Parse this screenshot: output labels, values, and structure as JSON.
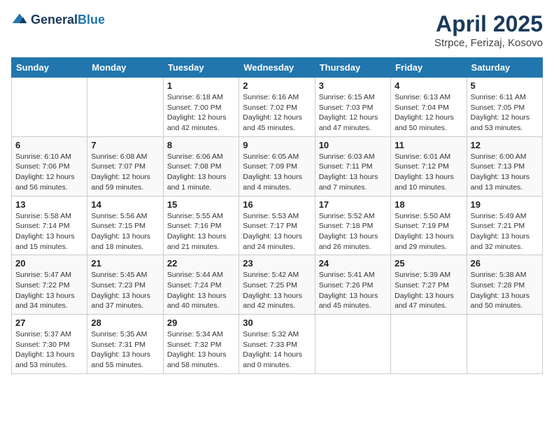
{
  "header": {
    "logo_general": "General",
    "logo_blue": "Blue",
    "month_title": "April 2025",
    "location": "Strpce, Ferizaj, Kosovo"
  },
  "weekdays": [
    "Sunday",
    "Monday",
    "Tuesday",
    "Wednesday",
    "Thursday",
    "Friday",
    "Saturday"
  ],
  "weeks": [
    [
      {
        "day": "",
        "content": ""
      },
      {
        "day": "",
        "content": ""
      },
      {
        "day": "1",
        "content": "Sunrise: 6:18 AM\nSunset: 7:00 PM\nDaylight: 12 hours and 42 minutes."
      },
      {
        "day": "2",
        "content": "Sunrise: 6:16 AM\nSunset: 7:02 PM\nDaylight: 12 hours and 45 minutes."
      },
      {
        "day": "3",
        "content": "Sunrise: 6:15 AM\nSunset: 7:03 PM\nDaylight: 12 hours and 47 minutes."
      },
      {
        "day": "4",
        "content": "Sunrise: 6:13 AM\nSunset: 7:04 PM\nDaylight: 12 hours and 50 minutes."
      },
      {
        "day": "5",
        "content": "Sunrise: 6:11 AM\nSunset: 7:05 PM\nDaylight: 12 hours and 53 minutes."
      }
    ],
    [
      {
        "day": "6",
        "content": "Sunrise: 6:10 AM\nSunset: 7:06 PM\nDaylight: 12 hours and 56 minutes."
      },
      {
        "day": "7",
        "content": "Sunrise: 6:08 AM\nSunset: 7:07 PM\nDaylight: 12 hours and 59 minutes."
      },
      {
        "day": "8",
        "content": "Sunrise: 6:06 AM\nSunset: 7:08 PM\nDaylight: 13 hours and 1 minute."
      },
      {
        "day": "9",
        "content": "Sunrise: 6:05 AM\nSunset: 7:09 PM\nDaylight: 13 hours and 4 minutes."
      },
      {
        "day": "10",
        "content": "Sunrise: 6:03 AM\nSunset: 7:11 PM\nDaylight: 13 hours and 7 minutes."
      },
      {
        "day": "11",
        "content": "Sunrise: 6:01 AM\nSunset: 7:12 PM\nDaylight: 13 hours and 10 minutes."
      },
      {
        "day": "12",
        "content": "Sunrise: 6:00 AM\nSunset: 7:13 PM\nDaylight: 13 hours and 13 minutes."
      }
    ],
    [
      {
        "day": "13",
        "content": "Sunrise: 5:58 AM\nSunset: 7:14 PM\nDaylight: 13 hours and 15 minutes."
      },
      {
        "day": "14",
        "content": "Sunrise: 5:56 AM\nSunset: 7:15 PM\nDaylight: 13 hours and 18 minutes."
      },
      {
        "day": "15",
        "content": "Sunrise: 5:55 AM\nSunset: 7:16 PM\nDaylight: 13 hours and 21 minutes."
      },
      {
        "day": "16",
        "content": "Sunrise: 5:53 AM\nSunset: 7:17 PM\nDaylight: 13 hours and 24 minutes."
      },
      {
        "day": "17",
        "content": "Sunrise: 5:52 AM\nSunset: 7:18 PM\nDaylight: 13 hours and 26 minutes."
      },
      {
        "day": "18",
        "content": "Sunrise: 5:50 AM\nSunset: 7:19 PM\nDaylight: 13 hours and 29 minutes."
      },
      {
        "day": "19",
        "content": "Sunrise: 5:49 AM\nSunset: 7:21 PM\nDaylight: 13 hours and 32 minutes."
      }
    ],
    [
      {
        "day": "20",
        "content": "Sunrise: 5:47 AM\nSunset: 7:22 PM\nDaylight: 13 hours and 34 minutes."
      },
      {
        "day": "21",
        "content": "Sunrise: 5:45 AM\nSunset: 7:23 PM\nDaylight: 13 hours and 37 minutes."
      },
      {
        "day": "22",
        "content": "Sunrise: 5:44 AM\nSunset: 7:24 PM\nDaylight: 13 hours and 40 minutes."
      },
      {
        "day": "23",
        "content": "Sunrise: 5:42 AM\nSunset: 7:25 PM\nDaylight: 13 hours and 42 minutes."
      },
      {
        "day": "24",
        "content": "Sunrise: 5:41 AM\nSunset: 7:26 PM\nDaylight: 13 hours and 45 minutes."
      },
      {
        "day": "25",
        "content": "Sunrise: 5:39 AM\nSunset: 7:27 PM\nDaylight: 13 hours and 47 minutes."
      },
      {
        "day": "26",
        "content": "Sunrise: 5:38 AM\nSunset: 7:28 PM\nDaylight: 13 hours and 50 minutes."
      }
    ],
    [
      {
        "day": "27",
        "content": "Sunrise: 5:37 AM\nSunset: 7:30 PM\nDaylight: 13 hours and 53 minutes."
      },
      {
        "day": "28",
        "content": "Sunrise: 5:35 AM\nSunset: 7:31 PM\nDaylight: 13 hours and 55 minutes."
      },
      {
        "day": "29",
        "content": "Sunrise: 5:34 AM\nSunset: 7:32 PM\nDaylight: 13 hours and 58 minutes."
      },
      {
        "day": "30",
        "content": "Sunrise: 5:32 AM\nSunset: 7:33 PM\nDaylight: 14 hours and 0 minutes."
      },
      {
        "day": "",
        "content": ""
      },
      {
        "day": "",
        "content": ""
      },
      {
        "day": "",
        "content": ""
      }
    ]
  ]
}
